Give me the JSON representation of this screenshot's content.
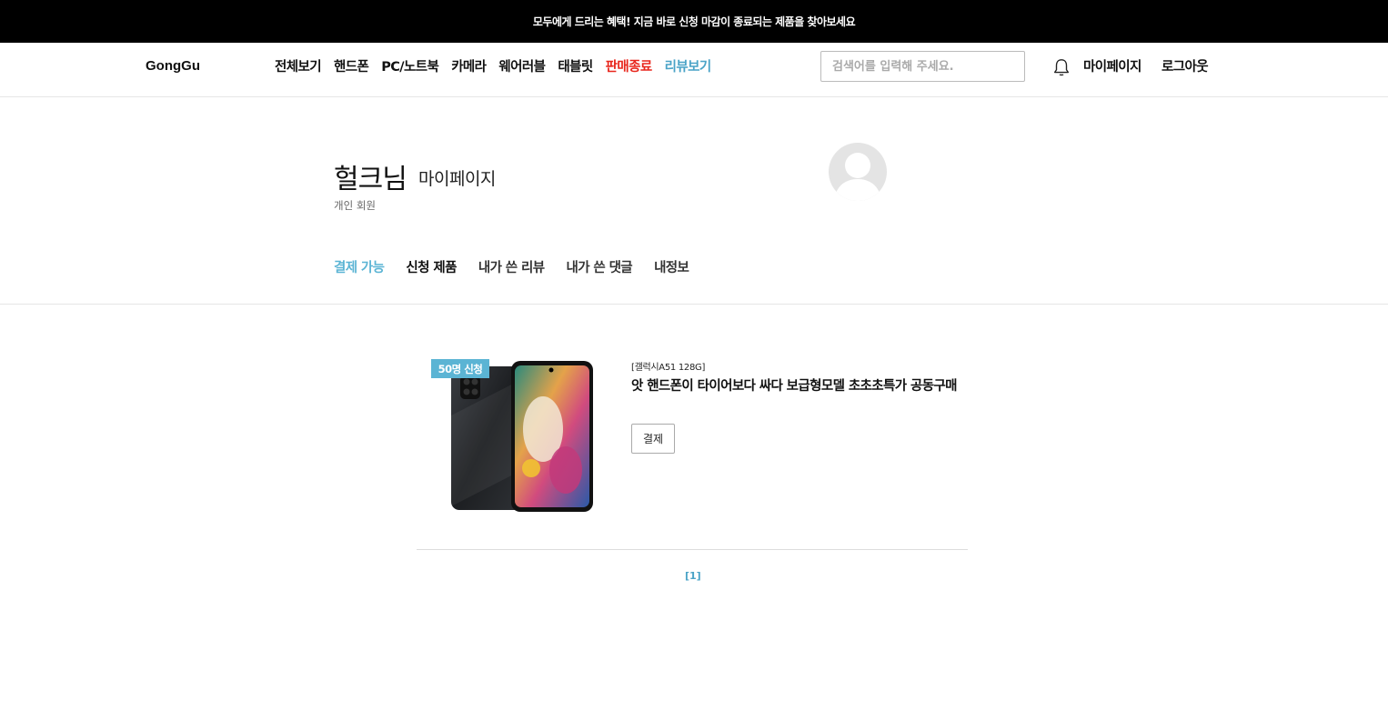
{
  "top_banner": {
    "text": "모두에게 드리는 혜택! 지금 바로 신청 마감이 종료되는 제품을 찾아보세요"
  },
  "header": {
    "logo": "GongGu",
    "nav": [
      {
        "label": "전체보기",
        "color": "#111111"
      },
      {
        "label": "핸드폰",
        "color": "#111111"
      },
      {
        "label": "PC/노트북",
        "color": "#111111"
      },
      {
        "label": "카메라",
        "color": "#111111"
      },
      {
        "label": "웨어러블",
        "color": "#111111"
      },
      {
        "label": "태블릿",
        "color": "#111111"
      },
      {
        "label": "판매종료",
        "color": "#e8261c"
      },
      {
        "label": "리뷰보기",
        "color": "#4aa3c7"
      }
    ],
    "search": {
      "placeholder": "검색어를 입력해 주세요.",
      "value": ""
    },
    "bell_icon": "bell-icon",
    "mypage": "마이페이지",
    "logout": "로그아웃"
  },
  "profile": {
    "name": "헐크님",
    "subtitle": "마이페이지",
    "member_type": "개인 회원",
    "avatar_icon": "default-avatar-icon"
  },
  "tabs": [
    {
      "label": "결제 가능",
      "active": true,
      "color": "#5bb4d4"
    },
    {
      "label": "신청 제품",
      "active": false,
      "color": "#111111"
    },
    {
      "label": "내가 쓴 리뷰",
      "active": false,
      "color": "#333333"
    },
    {
      "label": "내가 쓴 댓글",
      "active": false,
      "color": "#333333"
    },
    {
      "label": "내정보",
      "active": false,
      "color": "#333333"
    }
  ],
  "product": {
    "badge": "50명 신청",
    "code": "[갤럭시A51 128G]",
    "title": "앗 핸드폰이 타이어보다 싸다 보급형모델 초초초특가 공동구매",
    "pay_button": "결제"
  },
  "pagination": {
    "label": "[1]"
  }
}
